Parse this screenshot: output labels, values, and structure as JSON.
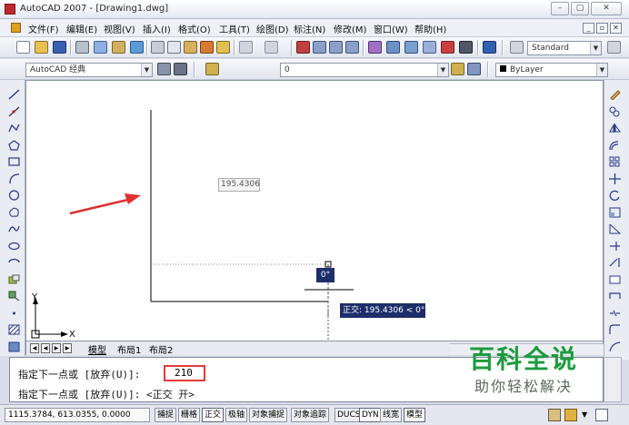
{
  "window": {
    "title": "AutoCAD 2007 - [Drawing1.dwg]",
    "min": "–",
    "max": "▢",
    "close": "✕"
  },
  "menu": {
    "items": [
      "文件(F)",
      "编辑(E)",
      "视图(V)",
      "插入(I)",
      "格式(O)",
      "工具(T)",
      "绘图(D)",
      "标注(N)",
      "修改(M)",
      "窗口(W)",
      "帮助(H)"
    ],
    "mdi_min": "_",
    "mdi_restore": "▫",
    "mdi_close": "✕"
  },
  "toolbar": {
    "text_style": "Standard",
    "workspace": "AutoCAD 经典",
    "layer": "0",
    "color": "ByLayer"
  },
  "drawing": {
    "dynamic_input_value": "195.4306",
    "angle_tooltip": "0°",
    "ortho_tooltip": "正交: 195.4306 < 0°",
    "ucs_x": "X",
    "ucs_y": "Y"
  },
  "layout_tabs": [
    "模型",
    "布局1",
    "布局2"
  ],
  "command": {
    "prompt_1": "指定下一点或 [放弃(U)]:",
    "input_value": "210",
    "prompt_2": "指定下一点或 [放弃(U)]:  <正交 开>"
  },
  "status": {
    "coordinates": "1115.3784, 613.0355, 0.0000",
    "buttons": [
      {
        "label": "捕捉",
        "on": false
      },
      {
        "label": "栅格",
        "on": false
      },
      {
        "label": "正交",
        "on": true
      },
      {
        "label": "极轴",
        "on": false
      },
      {
        "label": "对象捕捉",
        "on": false
      },
      {
        "label": "对象追踪",
        "on": false
      },
      {
        "label": "DUCS",
        "on": false
      },
      {
        "label": "DYN",
        "on": true
      },
      {
        "label": "线宽",
        "on": false
      },
      {
        "label": "模型",
        "on": true
      }
    ]
  },
  "watermark": {
    "title": "百科全说",
    "subtitle": "助你轻松解决"
  },
  "colors": {
    "accent_red": "#e53a3a",
    "tooltip_navy": "#1d2e6b",
    "watermark_green": "#1e9b3d"
  }
}
